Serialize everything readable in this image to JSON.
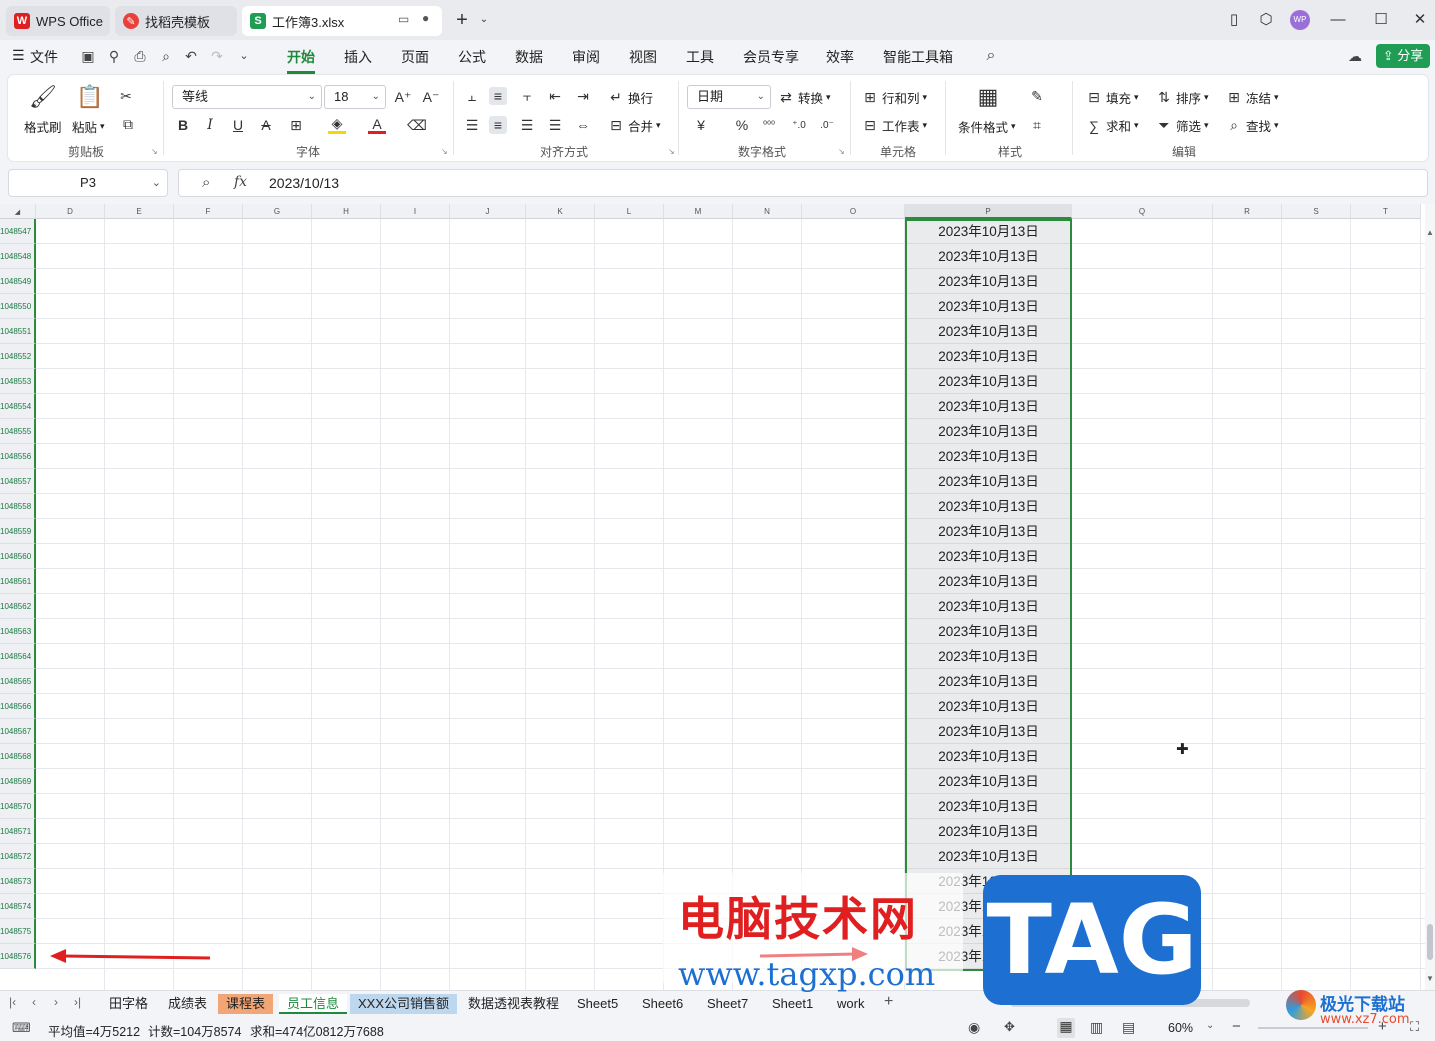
{
  "tabs": [
    {
      "label": "WPS Office"
    },
    {
      "label": "找稻壳模板"
    },
    {
      "label": "工作簿3.xlsx"
    }
  ],
  "avatar_initials": "WP",
  "menu": {
    "file": "文件",
    "items": [
      "开始",
      "插入",
      "页面",
      "公式",
      "数据",
      "审阅",
      "视图",
      "工具",
      "会员专享",
      "效率",
      "智能工具箱"
    ],
    "share": "分享"
  },
  "ribbon": {
    "clipboard": {
      "format_painter": "格式刷",
      "paste": "粘贴",
      "label": "剪贴板"
    },
    "font": {
      "name": "等线",
      "size": "18",
      "label": "字体"
    },
    "align": {
      "wrap": "换行",
      "merge": "合并",
      "label": "对齐方式"
    },
    "number": {
      "format": "日期",
      "convert": "转换",
      "label": "数字格式"
    },
    "cells": {
      "rows_cols": "行和列",
      "worksheet": "工作表",
      "label": "单元格"
    },
    "styles": {
      "conditional": "条件格式",
      "label": "样式"
    },
    "edit": {
      "fill": "填充",
      "sort": "排序",
      "freeze": "冻结",
      "sum": "求和",
      "filter": "筛选",
      "find": "查找",
      "label": "编辑"
    }
  },
  "formula_bar": {
    "cell_ref": "P3",
    "fx": "fx",
    "value": "2023/10/13"
  },
  "columns": [
    "D",
    "E",
    "F",
    "G",
    "H",
    "I",
    "J",
    "K",
    "L",
    "M",
    "N",
    "O",
    "P",
    "Q",
    "R",
    "S",
    "T"
  ],
  "rows": [
    "1048547",
    "1048548",
    "1048549",
    "1048550",
    "1048551",
    "1048552",
    "1048553",
    "1048554",
    "1048555",
    "1048556",
    "1048557",
    "1048558",
    "1048559",
    "1048560",
    "1048561",
    "1048562",
    "1048563",
    "1048564",
    "1048565",
    "1048566",
    "1048567",
    "1048568",
    "1048569",
    "1048570",
    "1048571",
    "1048572",
    "1048573",
    "1048574",
    "1048575",
    "1048576"
  ],
  "cell_value": "2023年10月13日",
  "sheets": [
    "田字格",
    "成绩表",
    "课程表",
    "员工信息",
    "XXX公司销售额",
    "数据透视表教程",
    "Sheet5",
    "Sheet6",
    "Sheet7",
    "Sheet1",
    "work"
  ],
  "status": {
    "average": "平均值=4万5212",
    "count": "计数=104万8574",
    "sum": "求和=474亿0812万7688",
    "zoom": "60%"
  },
  "watermark": {
    "cn": "电脑技术网",
    "url": "www.tagxp.com",
    "tag": "TAG",
    "logo2": "极光下载站",
    "url2": "www.xz7.com"
  }
}
